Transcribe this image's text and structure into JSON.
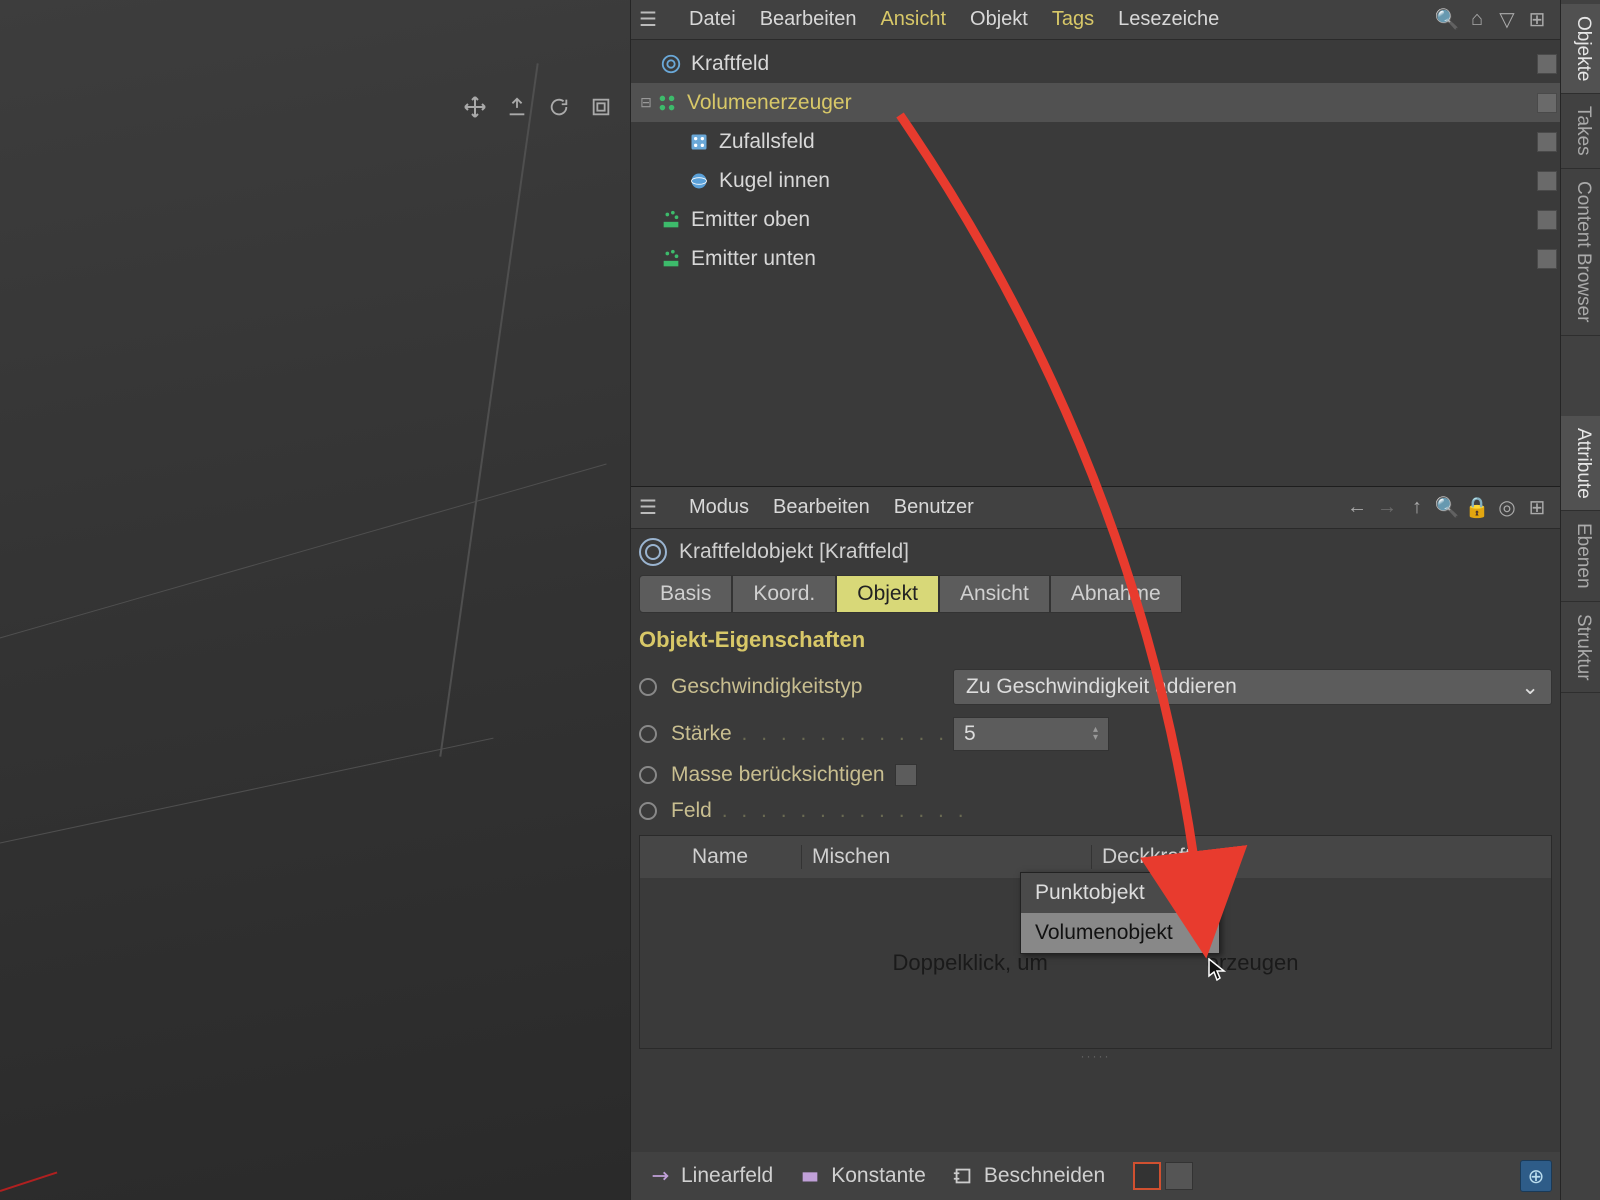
{
  "objects": {
    "menu": {
      "datei": "Datei",
      "bearbeiten": "Bearbeiten",
      "ansicht": "Ansicht",
      "objekt": "Objekt",
      "tags": "Tags",
      "lesezeiche": "Lesezeiche"
    },
    "tree": [
      {
        "label": "Kraftfeld",
        "icon": "forcefield",
        "indent": 0,
        "sel": false
      },
      {
        "label": "Volumenerzeuger",
        "icon": "volume",
        "indent": 0,
        "sel": true,
        "expander": "minus"
      },
      {
        "label": "Zufallsfeld",
        "icon": "random",
        "indent": 1,
        "sel": false
      },
      {
        "label": "Kugel innen",
        "icon": "sphere",
        "indent": 1,
        "sel": false,
        "extra": true
      },
      {
        "label": "Emitter oben",
        "icon": "emitter",
        "indent": 0,
        "sel": false
      },
      {
        "label": "Emitter unten",
        "icon": "emitter",
        "indent": 0,
        "sel": false
      }
    ]
  },
  "attributes": {
    "menu": {
      "modus": "Modus",
      "bearbeiten": "Bearbeiten",
      "benutzer": "Benutzer"
    },
    "object_name": "Kraftfeldobjekt [Kraftfeld]",
    "tabs": {
      "basis": "Basis",
      "koord": "Koord.",
      "objekt": "Objekt",
      "ansicht": "Ansicht",
      "abnahme": "Abnahme"
    },
    "section": "Objekt-Eigenschaften",
    "props": {
      "velocity_label": "Geschwindigkeitstyp",
      "velocity_value": "Zu Geschwindigkeit addieren",
      "strength_label": "Stärke",
      "strength_value": "5",
      "mass_label": "Masse berücksichtigen",
      "field_label": "Feld"
    },
    "table": {
      "name": "Name",
      "mix": "Mischen",
      "opacity": "Deckkraft",
      "placeholder_pre": "Doppelklick, um ",
      "placeholder_post": "erzeugen"
    },
    "context": {
      "point": "Punktobjekt",
      "volume": "Volumenobjekt"
    },
    "bottom": {
      "linear": "Linearfeld",
      "constant": "Konstante",
      "clip": "Beschneiden"
    }
  },
  "sidetabs": {
    "objekte": "Objekte",
    "takes": "Takes",
    "content": "Content Browser",
    "attribute": "Attribute",
    "ebenen": "Ebenen",
    "struktur": "Struktur"
  }
}
